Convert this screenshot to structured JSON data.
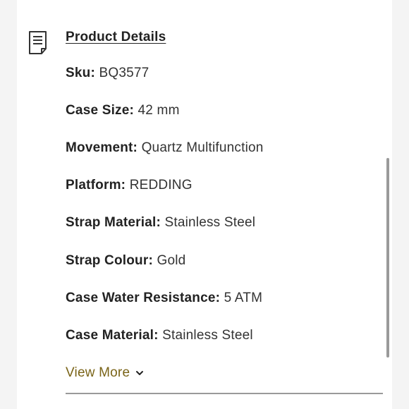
{
  "section": {
    "title": "Product Details",
    "icon": "document-icon"
  },
  "details": [
    {
      "label": "Sku:",
      "value": "BQ3577"
    },
    {
      "label": "Case Size:",
      "value": "42 mm"
    },
    {
      "label": "Movement:",
      "value": "Quartz Multifunction"
    },
    {
      "label": "Platform:",
      "value": "REDDING"
    },
    {
      "label": "Strap Material:",
      "value": "Stainless Steel"
    },
    {
      "label": "Strap Colour:",
      "value": "Gold"
    },
    {
      "label": "Case Water Resistance:",
      "value": "5 ATM"
    },
    {
      "label": "Case Material:",
      "value": "Stainless Steel"
    }
  ],
  "actions": {
    "view_more_label": "View More"
  },
  "colors": {
    "accent": "#7a6418",
    "text": "#222222",
    "background": "#f4f4f4",
    "panel": "#ffffff"
  }
}
